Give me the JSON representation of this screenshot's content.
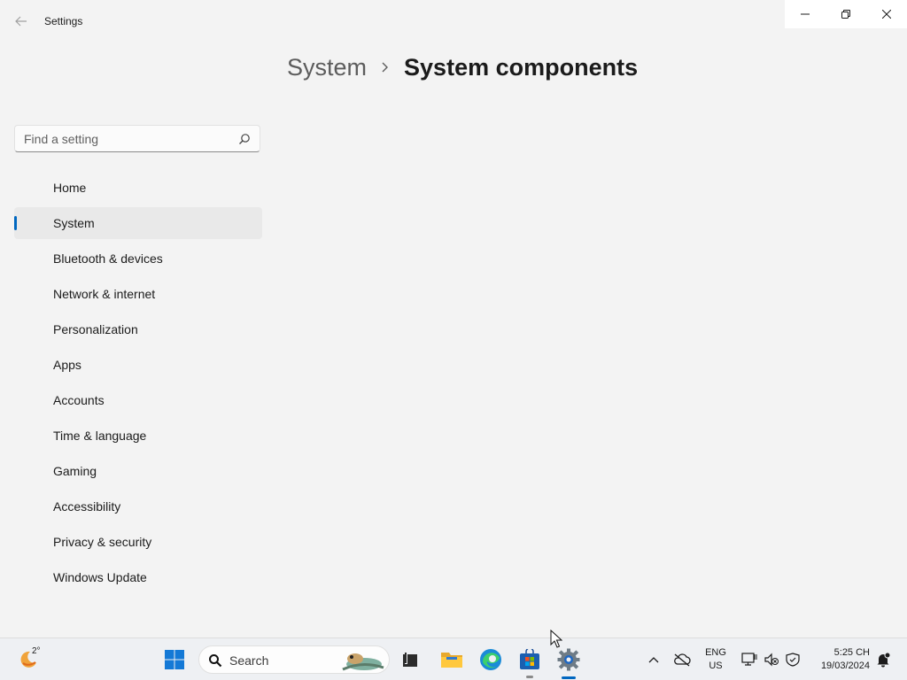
{
  "window": {
    "app_title": "Settings",
    "controls": [
      "minimize-icon",
      "restore-icon",
      "close-icon"
    ]
  },
  "breadcrumb": {
    "parent": "System",
    "current": "System components"
  },
  "search": {
    "placeholder": "Find a setting",
    "value": ""
  },
  "nav": {
    "selected": "System",
    "items": [
      {
        "label": "Home"
      },
      {
        "label": "System"
      },
      {
        "label": "Bluetooth & devices"
      },
      {
        "label": "Network & internet"
      },
      {
        "label": "Personalization"
      },
      {
        "label": "Apps"
      },
      {
        "label": "Accounts"
      },
      {
        "label": "Time & language"
      },
      {
        "label": "Gaming"
      },
      {
        "label": "Accessibility"
      },
      {
        "label": "Privacy & security"
      },
      {
        "label": "Windows Update"
      }
    ]
  },
  "taskbar": {
    "weather_temp": "2°",
    "search_label": "Search",
    "apps": [
      "start-icon",
      "task-view-icon",
      "file-explorer-icon",
      "edge-icon",
      "store-icon",
      "settings-icon"
    ],
    "language_line1": "ENG",
    "language_line2": "US",
    "time": "5:25 CH",
    "date": "19/03/2024"
  },
  "colors": {
    "accent": "#0067c0",
    "background": "#f3f3f3"
  }
}
